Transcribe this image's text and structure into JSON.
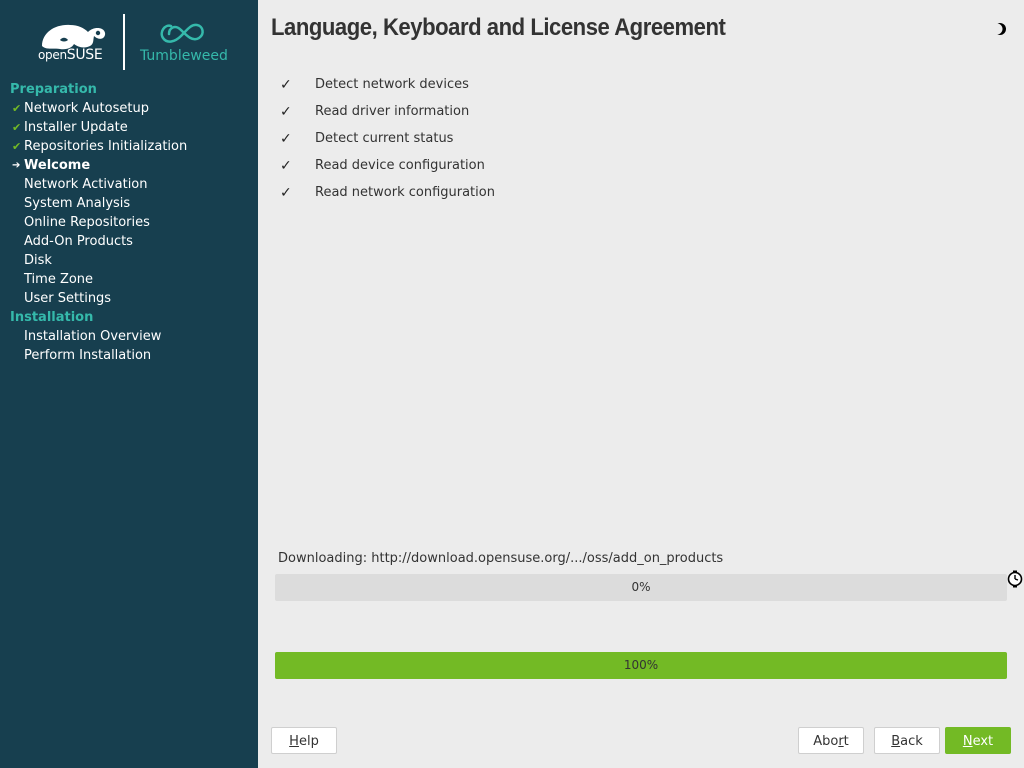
{
  "branding": {
    "opensuse_prefix": "open",
    "opensuse_name": "SUSE",
    "product": "Tumbleweed"
  },
  "sidebar": {
    "sections": [
      {
        "heading": "Preparation",
        "steps": [
          {
            "label": "Network Autosetup",
            "state": "done"
          },
          {
            "label": "Installer Update",
            "state": "done"
          },
          {
            "label": "Repositories Initialization",
            "state": "done"
          },
          {
            "label": "Welcome",
            "state": "current"
          },
          {
            "label": "Network Activation",
            "state": "pending"
          },
          {
            "label": "System Analysis",
            "state": "pending"
          },
          {
            "label": "Online Repositories",
            "state": "pending"
          },
          {
            "label": "Add-On Products",
            "state": "pending"
          },
          {
            "label": "Disk",
            "state": "pending"
          },
          {
            "label": "Time Zone",
            "state": "pending"
          },
          {
            "label": "User Settings",
            "state": "pending"
          }
        ]
      },
      {
        "heading": "Installation",
        "steps": [
          {
            "label": "Installation Overview",
            "state": "pending"
          },
          {
            "label": "Perform Installation",
            "state": "pending"
          }
        ]
      }
    ]
  },
  "main": {
    "title": "Language, Keyboard and License Agreement",
    "tasks": [
      {
        "label": "Detect network devices",
        "done": true
      },
      {
        "label": "Read driver information",
        "done": true
      },
      {
        "label": "Detect current status",
        "done": true
      },
      {
        "label": "Read device configuration",
        "done": true
      },
      {
        "label": "Read network configuration",
        "done": true
      }
    ],
    "download_label": "Downloading: http://download.opensuse.org/.../oss/add_on_products",
    "download_progress": {
      "value": 0,
      "text": "0%"
    },
    "total_progress": {
      "value": 100,
      "text": "100%"
    }
  },
  "buttons": {
    "help": {
      "accel": "H",
      "rest": "elp"
    },
    "abort": {
      "pre": "Abo",
      "accel": "r",
      "rest": "t"
    },
    "back": {
      "accel": "B",
      "rest": "ack"
    },
    "next": {
      "accel": "N",
      "rest": "ext"
    }
  },
  "colors": {
    "sidebar_bg": "#173f4f",
    "accent_teal": "#35b9ab",
    "accent_green": "#73ba25",
    "main_bg": "#ececec"
  },
  "icons": {
    "done_mark": "✔",
    "current_mark": "➔",
    "task_check": "✓"
  }
}
